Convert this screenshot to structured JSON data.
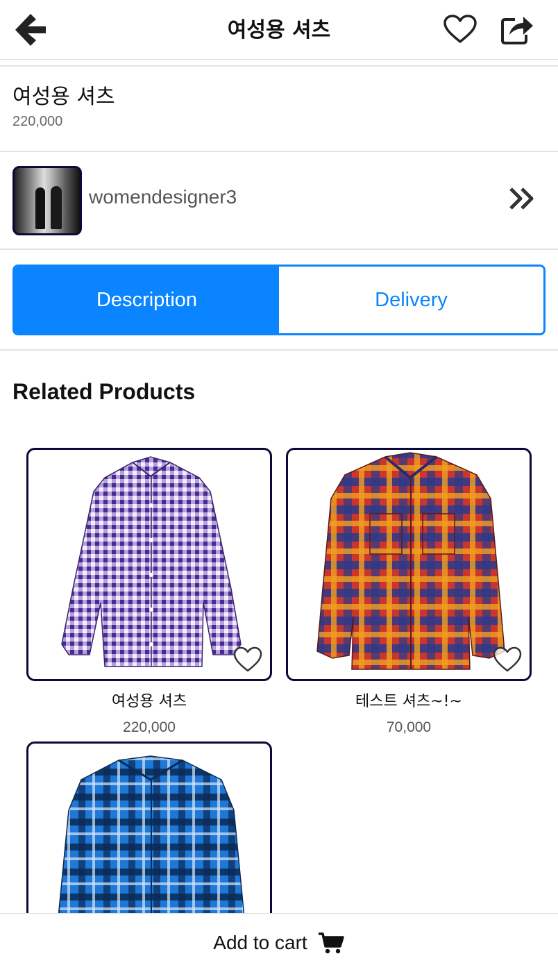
{
  "header": {
    "title": "여성용 셔츠",
    "back_icon": "arrow-left-icon",
    "favorite_icon": "heart-outline-icon",
    "share_icon": "share-icon"
  },
  "product": {
    "name": "여성용 셔츠",
    "price": "220,000"
  },
  "seller": {
    "name": "womendesigner3",
    "chevron_icon": "double-chevron-right-icon"
  },
  "tabs": [
    {
      "label": "Description",
      "active": true
    },
    {
      "label": "Delivery",
      "active": false
    }
  ],
  "related": {
    "title": "Related Products",
    "items": [
      {
        "name": "여성용 셔츠",
        "price": "220,000",
        "pattern": "purple-gingham"
      },
      {
        "name": "테스트 셔츠~!~",
        "price": "70,000",
        "pattern": "orange-plaid"
      },
      {
        "name": "",
        "price": "",
        "pattern": "blue-plaid"
      }
    ]
  },
  "footer": {
    "add_to_cart": "Add to cart",
    "cart_icon": "cart-icon"
  },
  "colors": {
    "accent": "#0a84ff",
    "card_border": "#0a0a3a"
  }
}
